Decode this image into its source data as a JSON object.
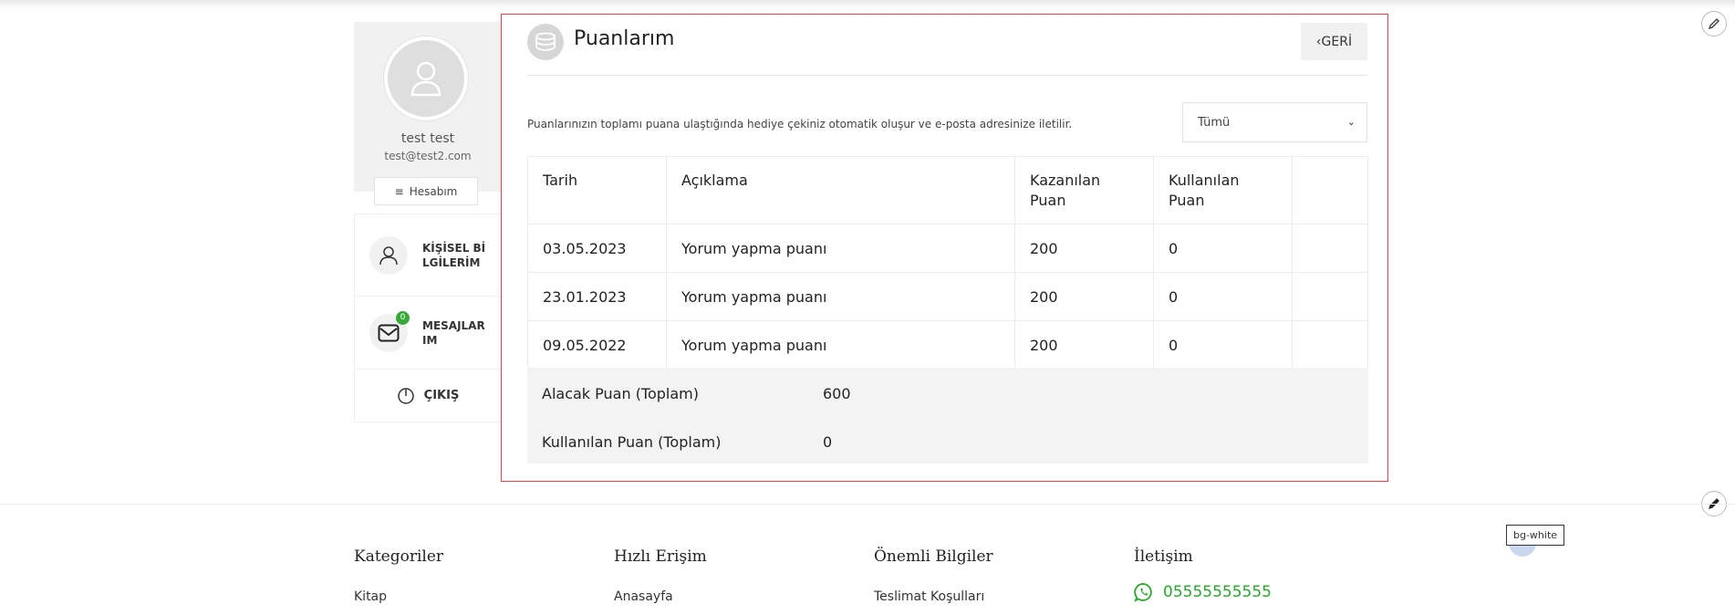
{
  "sidebar": {
    "user_name": "test test",
    "user_email": "test@test2.com",
    "account_button": "Hesabım",
    "items": [
      {
        "label": "KİŞİSEL BİLGİLERİM"
      },
      {
        "label": "MESAJLARIM",
        "badge": "0"
      },
      {
        "label": "ÇIKIŞ"
      }
    ]
  },
  "main": {
    "title": "Puanlarım",
    "back_label": "GERİ",
    "info_text": "Puanlarınızın toplamı puana ulaştığında hediye çekiniz otomatik oluşur ve e-posta adresinize iletilir.",
    "filter_value": "Tümü",
    "table": {
      "headers": [
        "Tarih",
        "Açıklama",
        "Kazanılan Puan",
        "Kullanılan Puan",
        ""
      ],
      "rows": [
        [
          "03.05.2023",
          "Yorum yapma puanı",
          "200",
          "0"
        ],
        [
          "23.01.2023",
          "Yorum yapma puanı",
          "200",
          "0"
        ],
        [
          "09.05.2022",
          "Yorum yapma puanı",
          "200",
          "0"
        ]
      ]
    },
    "summary": {
      "receivable_label": "Alacak Puan (Toplam)",
      "receivable_value": "600",
      "used_label": "Kullanılan Puan (Toplam)",
      "used_value": "0"
    }
  },
  "tooltip": "bg-white",
  "footer": {
    "columns": [
      {
        "heading": "Kategoriler",
        "link": "Kitap"
      },
      {
        "heading": "Hızlı Erişim",
        "link": "Anasayfa"
      },
      {
        "heading": "Önemli Bilgiler",
        "link": "Teslimat Koşulları"
      },
      {
        "heading": "İletişim",
        "phone": "05555555555"
      }
    ]
  },
  "colors": {
    "accent_border": "#e8424a",
    "whatsapp_green": "#2ca52f",
    "badge_green": "#39a83a"
  }
}
